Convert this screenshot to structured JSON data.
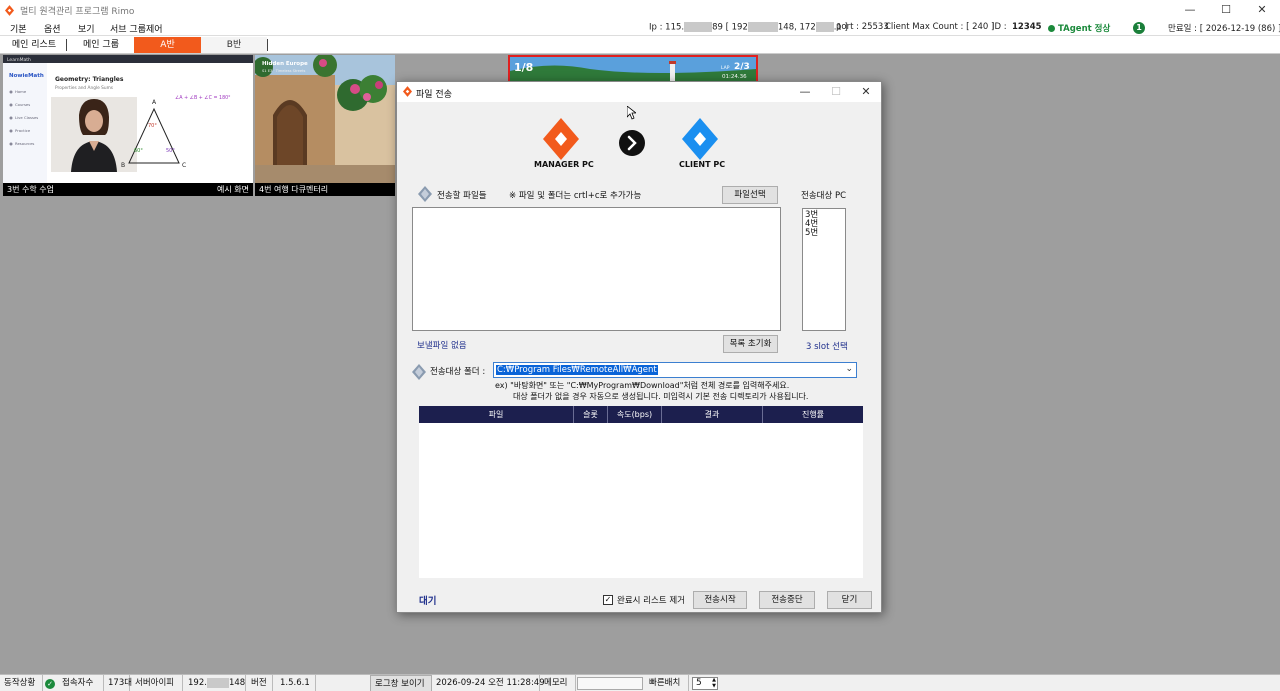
{
  "window": {
    "title": "멀티 원격관리 프로그램 Rimo",
    "controls": {
      "minimize": "—",
      "maximize": "☐",
      "close": "✕"
    }
  },
  "menu": [
    "기본",
    "옵션",
    "보기",
    "서브 그룹제어"
  ],
  "info": {
    "ip_label": "Ip : 115.",
    "ip_part2": "89 [ 192",
    "ip_part3": "148, 172",
    "ip_part4": ".1 ]",
    "port": "port : 25533",
    "client_max": "Client Max Count : [ 240 ]",
    "id_label": "ID :",
    "id_value": "12345",
    "tagent": "TAgent 정상",
    "badge": "1",
    "expiry": "만료일 : [ 2026-12-19 (86) ]"
  },
  "tabs": {
    "main_list": "메인 리스트",
    "main_group": "메인 그룹",
    "a_group": "A반",
    "b_group": "B반"
  },
  "thumbs": {
    "t1": {
      "caption": "3번  수학 수업",
      "right": "예시 화면",
      "brand": "LearnMath",
      "app_logo": "NowieMath",
      "lesson_title": "Geometry: Triangles",
      "lesson_sub": "Properties and Angle Sums",
      "nav": [
        "Home",
        "Courses",
        "Live Classes",
        "Practice",
        "Resources"
      ],
      "formula": "∠A + ∠B + ∠C = 180°",
      "angle_a": "70°",
      "angle_b": "60°",
      "angle_c": "50°",
      "vertex_a": "A",
      "vertex_b": "B",
      "vertex_c": "C"
    },
    "t2": {
      "caption": "4번  여행 다큐멘터리",
      "title": "Hidden Europe",
      "subtitle": "S1 E3 · Timeless Streets"
    },
    "t3": {
      "position": "1/8",
      "lap_label": "LAP",
      "lap": "2/3",
      "time": "01:24.36"
    }
  },
  "dialog": {
    "title": "파일 전송",
    "manager_label": "MANAGER PC",
    "client_label": "CLIENT PC",
    "files_label": "전송할 파일들",
    "files_hint": "※ 파일 및 폴더는 crtl+c로 추가가능",
    "select_file_btn": "파일선택",
    "target_pc_label": "전송대상 PC",
    "target_pcs": [
      "3번",
      "4번",
      "5번"
    ],
    "no_files": "보낼파일 없음",
    "reset_list_btn": "목록 초기화",
    "slot_selected": "3 slot 선택",
    "folder_label": "전송대상 폴더 :",
    "folder_value": "C:₩Program Files₩RemoteAll₩Agent",
    "folder_hint1": "ex) \"바탕화면\" 또는 \"C:₩MyProgram₩Download\"처럼 전체 경로를 입력해주세요.",
    "folder_hint2": "대상 폴더가 없을 경우 자동으로 생성됩니다. 미입력시 기본 전송 디렉토리가 사용됩니다.",
    "columns": [
      "파일",
      "슬롯",
      "속도(bps)",
      "결과",
      "진행률"
    ],
    "status": "대기",
    "remove_on_done": "완료시 리스트 제거",
    "start_btn": "전송시작",
    "stop_btn": "전송중단",
    "close_btn": "닫기"
  },
  "statusbar": {
    "op_status": "동작상황",
    "conn_label": "접속자수",
    "conn_value": "173대",
    "server_ip_label": "서버아이피",
    "server_ip_a": "192.",
    "server_ip_b": "148",
    "version_label": "버전",
    "version_value": "1.5.6.1",
    "log_toggle": "로그창 보이기",
    "datetime": "2026-09-24 오전 11:28:49",
    "memory_label": "메모리",
    "quick_label": "빠른배치",
    "quick_value": "5"
  },
  "colors": {
    "accent_orange": "#f25a1c",
    "client_blue": "#1a8ff0",
    "table_header": "#1c1f4e",
    "ok_green": "#1c8a3c"
  }
}
